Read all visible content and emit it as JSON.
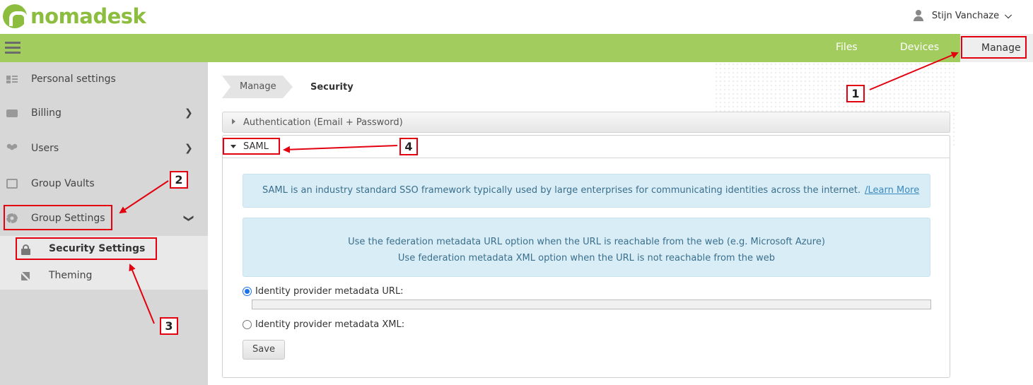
{
  "header": {
    "brand": "nomadesk",
    "user_name": "Stijn Vanchaze"
  },
  "navbar": {
    "items": [
      "Files",
      "Devices",
      "Manage"
    ]
  },
  "sidebar": {
    "items": [
      {
        "label": "Personal settings",
        "icon": "person-card-icon"
      },
      {
        "label": "Billing",
        "icon": "credit-card-icon",
        "expand": "right"
      },
      {
        "label": "Users",
        "icon": "users-icon",
        "expand": "right"
      },
      {
        "label": "Group Vaults",
        "icon": "vault-icon"
      },
      {
        "label": "Group Settings",
        "icon": "gear-icon",
        "expand": "down"
      }
    ],
    "subitems": [
      {
        "label": "Security Settings",
        "icon": "lock-icon",
        "active": true
      },
      {
        "label": "Theming",
        "icon": "brush-icon"
      }
    ]
  },
  "breadcrumb": {
    "parent": "Manage",
    "current": "Security"
  },
  "accordion": {
    "auth_label": "Authentication (Email + Password)",
    "saml_label": "SAML"
  },
  "saml": {
    "info_text": "SAML is an industry standard SSO framework typically used by large enterprises for communicating identities across the internet.",
    "learn_more": "/Learn More",
    "hint_line1": "Use the federation metadata URL option when the URL is reachable from the web (e.g. Microsoft Azure)",
    "hint_line2": "Use federation metadata XML option when the URL is not reachable from the web",
    "option_url": "Identity provider metadata URL:",
    "option_xml": "Identity provider metadata XML:",
    "url_value": "",
    "selected_option": "url",
    "save_label": "Save"
  },
  "annotations": {
    "labels": [
      "1",
      "2",
      "3",
      "4"
    ],
    "color": "#e3000f"
  },
  "colors": {
    "brand_green": "#8cbd3f",
    "navbar_green": "#a3cc5e",
    "sidebar_bg": "#d7d7d7",
    "info_bg": "#d9edf7"
  }
}
